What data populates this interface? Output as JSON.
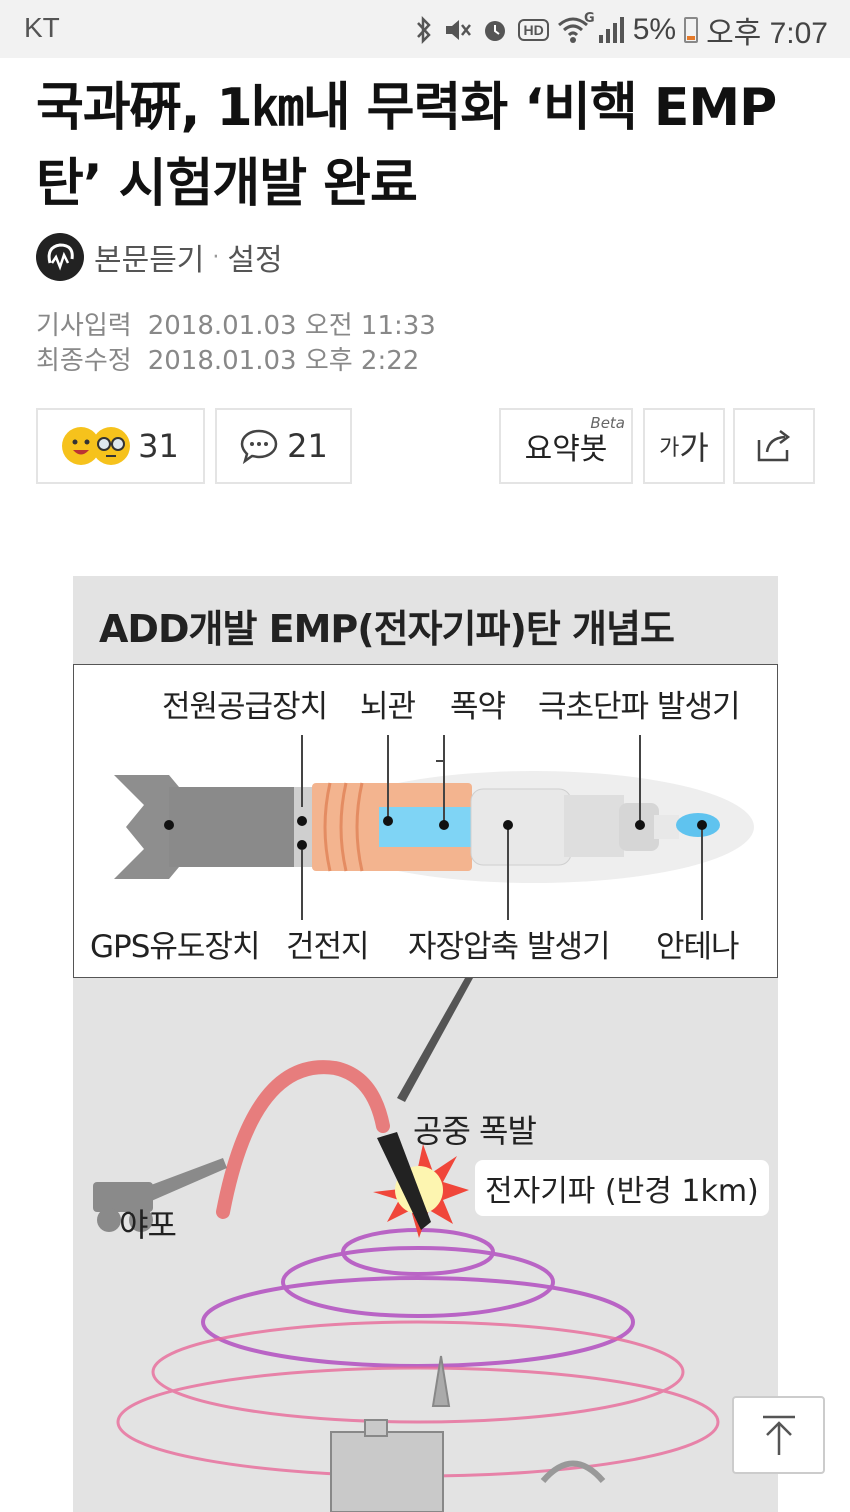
{
  "status_bar": {
    "carrier": "KT",
    "battery": "5%",
    "time": "오후 7:07",
    "icons": [
      "bluetooth-icon",
      "mute-icon",
      "alarm-icon",
      "hd-icon",
      "wifi-icon",
      "signal-icon",
      "battery-icon"
    ],
    "hd_label": "HD",
    "wifi_label": "G"
  },
  "article": {
    "title": "국과硏, 1㎞내 무력화 ‘비핵 EMP탄’ 시험개발 완료",
    "listen_label": "본문듣기",
    "separator": "·",
    "settings_label": "설정",
    "meta": [
      {
        "key": "기사입력",
        "value": "2018.01.03 오전 11:33"
      },
      {
        "key": "최종수정",
        "value": "2018.01.03 오후 2:22"
      }
    ]
  },
  "toolbar": {
    "reaction_count": "31",
    "comment_count": "21",
    "summary_label": "요약봇",
    "summary_beta": "Beta",
    "font_small": "가",
    "font_big": "가"
  },
  "figure": {
    "title": "ADD개발 EMP(전자기파)탄 개념도",
    "labels_top": [
      "전원공급장치",
      "뇌관",
      "폭약",
      "극초단파 발생기"
    ],
    "labels_bottom": [
      "GPS유도장치",
      "건전지",
      "자장압축 발생기",
      "안테나"
    ],
    "airburst_label": "공중 폭발",
    "radius_tag": "전자기파 (반경 1km)",
    "artillery_label": "야포",
    "colors": {
      "background": "#e3e3e3",
      "trajectory": "#e86b6b",
      "rings": "#b24fc0",
      "capacitor": "#f3b48f",
      "explosive": "#7fd4f5"
    }
  },
  "scroll_top_icon": "arrow-up-icon"
}
